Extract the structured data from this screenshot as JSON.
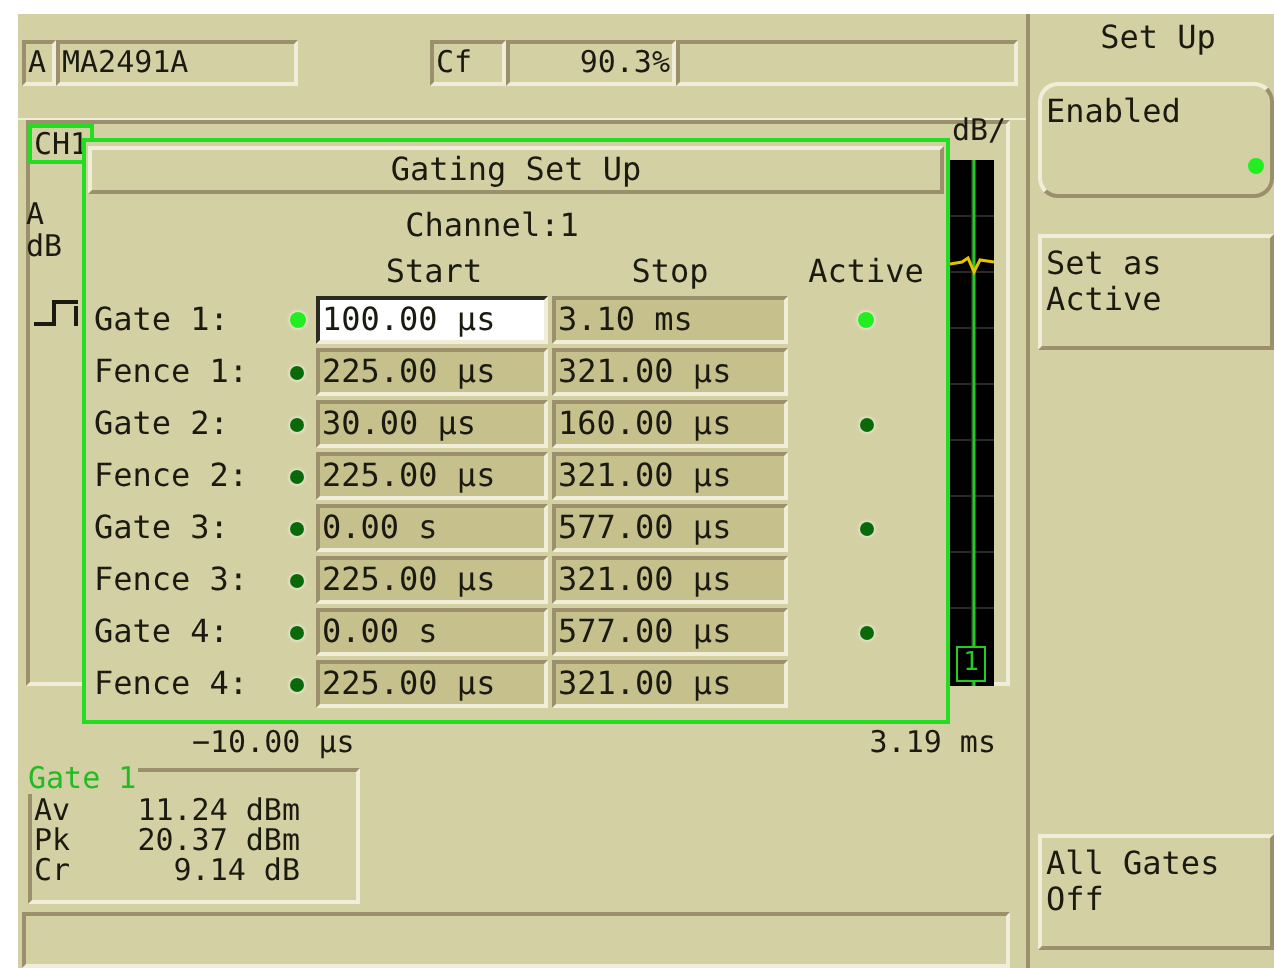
{
  "header": {
    "channel": "A",
    "sensor": "MA2491A",
    "cf_label": "Cf",
    "cf_value": "90.3%"
  },
  "graph": {
    "channel_label": "CH1",
    "scale_label": "dB/",
    "axis_labels": [
      "A",
      "dB"
    ],
    "x_start": "−10.00 μs",
    "x_end": "3.19 ms",
    "marker": "1"
  },
  "dialog": {
    "title": "Gating Set Up",
    "channel": "Channel:1",
    "columns": [
      "Start",
      "Stop",
      "Active"
    ],
    "rows": [
      {
        "label": "Gate 1:",
        "selected": true,
        "start": "100.00 μs",
        "stop": "3.10 ms",
        "active": true
      },
      {
        "label": "Fence 1:",
        "selected": false,
        "start": "225.00 μs",
        "stop": "321.00 μs",
        "active": false
      },
      {
        "label": "Gate 2:",
        "selected": false,
        "start": "30.00 μs",
        "stop": "160.00 μs",
        "active": true
      },
      {
        "label": "Fence 2:",
        "selected": false,
        "start": "225.00 μs",
        "stop": "321.00 μs",
        "active": false
      },
      {
        "label": "Gate 3:",
        "selected": false,
        "start": "0.00 s",
        "stop": "577.00 μs",
        "active": true
      },
      {
        "label": "Fence 3:",
        "selected": false,
        "start": "225.00 μs",
        "stop": "321.00 μs",
        "active": false
      },
      {
        "label": "Gate 4:",
        "selected": false,
        "start": "0.00 s",
        "stop": "577.00 μs",
        "active": true
      },
      {
        "label": "Fence 4:",
        "selected": false,
        "start": "225.00 μs",
        "stop": "321.00 μs",
        "active": false
      }
    ]
  },
  "readout": {
    "title": "Gate 1",
    "rows": [
      {
        "label": "Av",
        "value": "11.24 dBm"
      },
      {
        "label": "Pk",
        "value": "20.37 dBm"
      },
      {
        "label": "Cr",
        "value": "9.14 dB"
      }
    ]
  },
  "softkeys": {
    "title": "Set Up",
    "keys": [
      {
        "kind": "toggle",
        "label": "Enabled",
        "on": true
      },
      {
        "kind": "plain",
        "label": "Set as Active"
      },
      {
        "kind": "spacer"
      },
      {
        "kind": "plain",
        "label": "All Gates Off"
      }
    ]
  }
}
